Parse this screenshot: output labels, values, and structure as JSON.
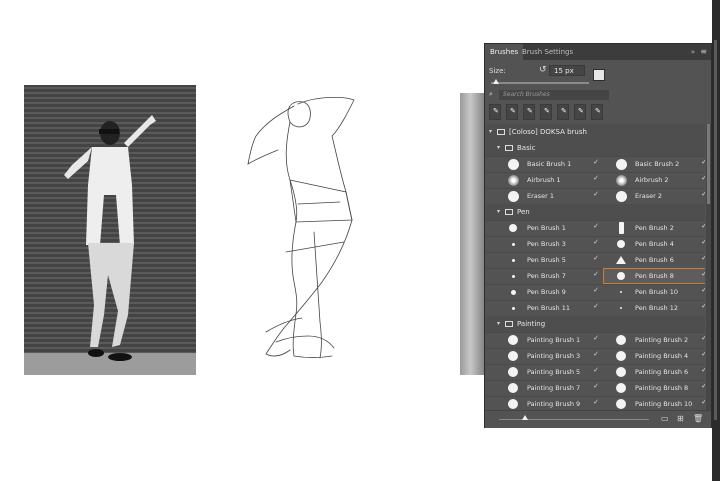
{
  "panel": {
    "tabs": [
      "Brushes",
      "Brush Settings"
    ],
    "collapse_icon": "double-chevron-right-icon",
    "menu_icon": "hamburger-menu-icon",
    "size_label": "Size:",
    "size_value": "15 px",
    "size_fraction": 0.05,
    "search_placeholder": "Search Brushes",
    "recent_brush_count": 7,
    "preview_fraction": 0.17
  },
  "groups": [
    {
      "name": "[Coloso] DOKSA brush",
      "level": 0
    },
    {
      "name": "Basic",
      "level": 1
    },
    {
      "name": "Pen",
      "level": 1
    },
    {
      "name": "Painting",
      "level": 1
    }
  ],
  "basic": [
    [
      "Basic Brush 1",
      "Basic Brush 2"
    ],
    [
      "Airbrush 1",
      "Airbrush 2"
    ],
    [
      "Eraser 1",
      "Eraser 2"
    ]
  ],
  "pen": [
    [
      "Pen Brush 1",
      "Pen Brush 2"
    ],
    [
      "Pen Brush 3",
      "Pen Brush 4"
    ],
    [
      "Pen Brush 5",
      "Pen Brush 6"
    ],
    [
      "Pen Brush 7",
      "Pen Brush 8"
    ],
    [
      "Pen Brush 9",
      "Pen Brush 10"
    ],
    [
      "Pen Brush 11",
      "Pen Brush 12"
    ]
  ],
  "painting": [
    [
      "Painting Brush 1",
      "Painting Brush 2"
    ],
    [
      "Painting Brush 3",
      "Painting Brush 4"
    ],
    [
      "Painting Brush 5",
      "Painting Brush 6"
    ],
    [
      "Painting Brush 7",
      "Painting Brush 8"
    ],
    [
      "Painting Brush 9",
      "Painting Brush 10"
    ]
  ],
  "selected_brush": "Pen Brush 8",
  "colors": {
    "panel_bg": "#535353",
    "tabbar_bg": "#3c3c3c",
    "selection_outline": "#d07a2e"
  }
}
